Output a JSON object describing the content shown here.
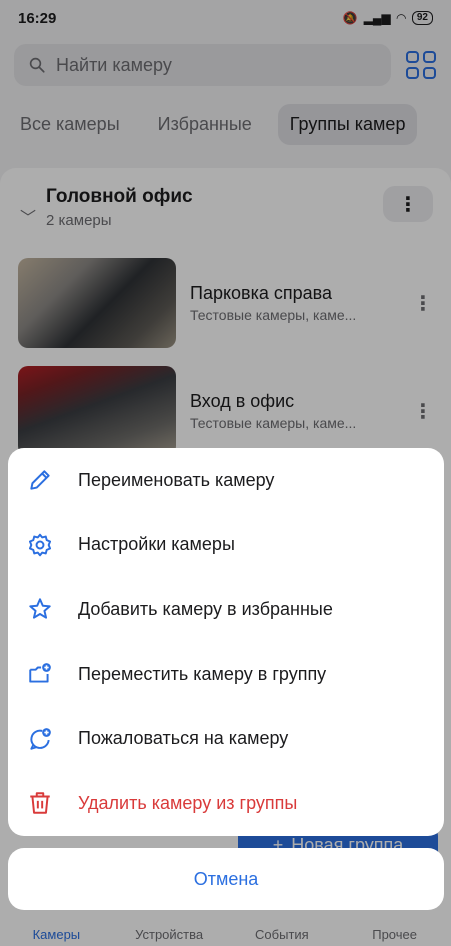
{
  "status_bar": {
    "time": "16:29",
    "battery": "92"
  },
  "search": {
    "placeholder": "Найти камеру"
  },
  "tabs": [
    {
      "label": "Все камеры"
    },
    {
      "label": "Избранные"
    },
    {
      "label": "Группы камер"
    }
  ],
  "group": {
    "title": "Головной офис",
    "subtitle": "2 камеры",
    "cameras": [
      {
        "name": "Парковка справа",
        "desc": "Тестовые камеры, каме..."
      },
      {
        "name": "Вход в офис",
        "desc": "Тестовые камеры, каме..."
      }
    ]
  },
  "new_group_label": "Новая группа",
  "bottom_nav": [
    {
      "label": "Камеры"
    },
    {
      "label": "Устройства"
    },
    {
      "label": "События"
    },
    {
      "label": "Прочее"
    }
  ],
  "sheet": {
    "items": [
      {
        "label": "Переименовать камеру",
        "icon": "pencil-icon"
      },
      {
        "label": "Настройки камеры",
        "icon": "gear-icon"
      },
      {
        "label": "Добавить камеру в избранные",
        "icon": "star-icon"
      },
      {
        "label": "Переместить камеру в группу",
        "icon": "folder-plus-icon"
      },
      {
        "label": "Пожаловаться на камеру",
        "icon": "chat-plus-icon"
      },
      {
        "label": "Удалить камеру из группы",
        "icon": "trash-icon"
      }
    ],
    "cancel_label": "Отмена"
  },
  "colors": {
    "accent": "#2b6fe0",
    "danger": "#d93a3a"
  }
}
